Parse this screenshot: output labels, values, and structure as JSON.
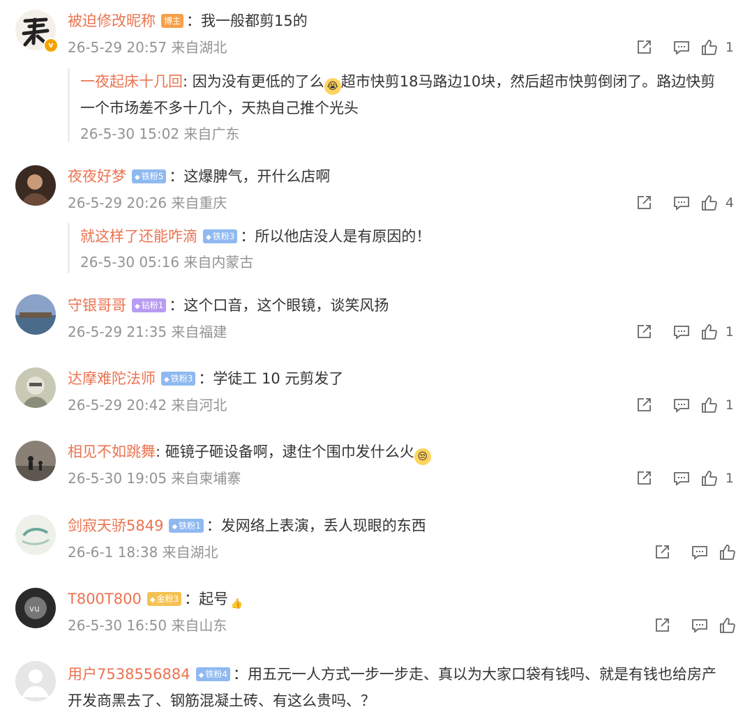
{
  "comments": [
    {
      "user": "被迫修改昵称",
      "badge": "博主",
      "sep": "：",
      "text": "我一般都剪15的",
      "meta": "26-5-29 20:57 来自湖北",
      "likes": "1",
      "reply": {
        "user": "一夜起床十几回",
        "sep": ": ",
        "text_a": "因为没有更低的了么",
        "text_b": "超市快剪18马路边10块，然后超市快剪倒闭了。路边快剪一个市场差不多十几个，天热自己推个光头",
        "meta": "26-5-30 15:02 来自广东"
      }
    },
    {
      "user": "夜夜好梦",
      "badge": "铁粉5",
      "sep": "：",
      "text": "这爆脾气，开什么店啊",
      "meta": "26-5-29 20:26 来自重庆",
      "likes": "4",
      "reply": {
        "user": "就这样了还能咋滴",
        "badge": "铁粉3",
        "sep": "：",
        "text": "所以他店没人是有原因的！",
        "meta": "26-5-30 05:16 来自内蒙古"
      }
    },
    {
      "user": "守银哥哥",
      "badge": "钻粉1",
      "sep": "：",
      "text": "这个口音，这个眼镜，谈笑风扬",
      "meta": "26-5-29 21:35 来自福建",
      "likes": "1"
    },
    {
      "user": "达摩难陀法师",
      "badge": "铁粉3",
      "sep": "：",
      "text": "学徒工 10 元剪发了",
      "meta": "26-5-29 20:42 来自河北",
      "likes": "1"
    },
    {
      "user": "相见不如跳舞",
      "sep": ": ",
      "text": "砸镜子砸设备啊，逮住个围巾发什么火",
      "meta": "26-5-30 19:05 来自柬埔寨",
      "likes": "1"
    },
    {
      "user": "剑寂天骄5849",
      "badge": "铁粉1",
      "sep": "：",
      "text": "发网络上表演，丢人现眼的东西",
      "meta": "26-6-1 18:38 来自湖北",
      "likes": ""
    },
    {
      "user": "T800T800",
      "badge": "金粉3",
      "sep": "：",
      "text": "起号",
      "meta": "26-5-30 16:50 来自山东",
      "likes": ""
    },
    {
      "user": "用户7538556884",
      "badge": "铁粉4",
      "sep": "：",
      "text": "用五元一人方式一步一步走、真以为大家口袋有钱吗、就是有钱也给房产开发商黑去了、钢筋混凝土砖、有这么贵吗、？"
    }
  ]
}
